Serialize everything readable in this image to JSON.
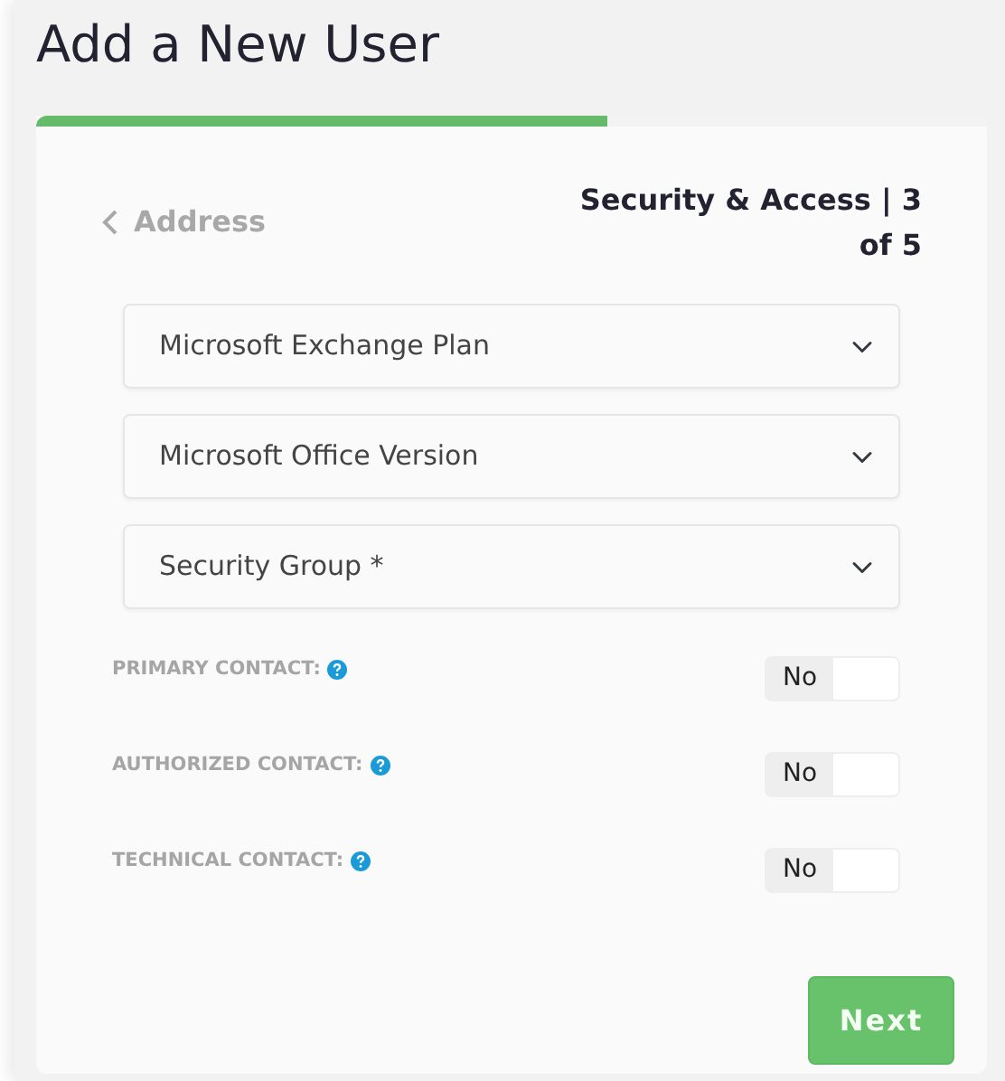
{
  "title": "Add a New User",
  "progress": {
    "level": 0.6
  },
  "back_link": "Address",
  "step": "Security & Access | 3 of 5",
  "selects": [
    {
      "placeholder": "Microsoft Exchange Plan"
    },
    {
      "placeholder": "Microsoft Office Version"
    },
    {
      "placeholder": "Security Group *"
    }
  ],
  "toggles": [
    {
      "label": "PRIMARY CONTACT:",
      "value": "No",
      "on": false
    },
    {
      "label": "AUTHORIZED CONTACT:",
      "value": "No",
      "on": false
    },
    {
      "label": "TECHNICAL CONTACT:",
      "value": "No",
      "on": false
    }
  ],
  "buttons": [
    "Next"
  ]
}
